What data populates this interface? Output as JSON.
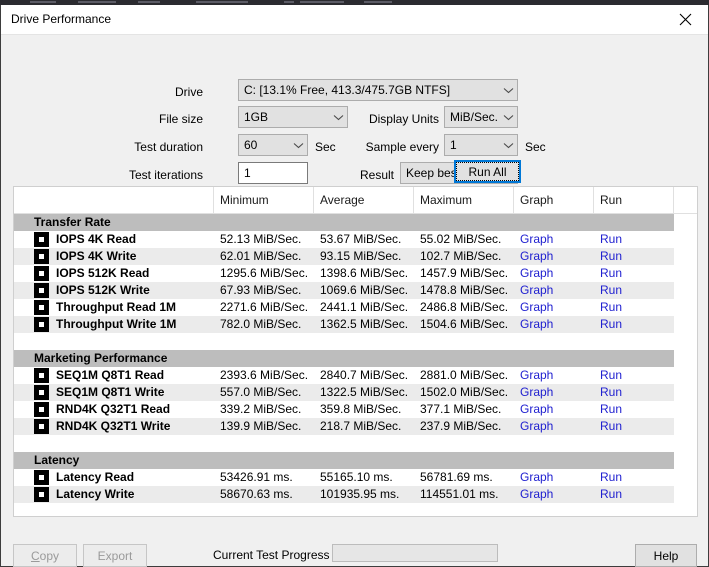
{
  "window": {
    "title": "Drive Performance",
    "close_icon": "close-icon"
  },
  "form": {
    "drive_label": "Drive",
    "drive_value": "C: [13.1% Free, 413.3/475.7GB NTFS]",
    "file_size_label": "File size",
    "file_size_value": "1GB",
    "display_units_label": "Display Units",
    "display_units_value": "MiB/Sec.",
    "test_duration_label": "Test duration",
    "test_duration_value": "60",
    "test_duration_unit": "Sec",
    "sample_every_label": "Sample every",
    "sample_every_value": "1",
    "sample_every_unit": "Sec",
    "test_iterations_label": "Test iterations",
    "test_iterations_value": "1",
    "result_label": "Result",
    "result_value": "Keep best result",
    "run_all_label": "Run All"
  },
  "table": {
    "columns": [
      "",
      "Minimum",
      "Average",
      "Maximum",
      "Graph",
      "Run"
    ],
    "graph_link": "Graph",
    "run_link": "Run",
    "groups": [
      {
        "title": "Transfer Rate",
        "rows": [
          {
            "name": "IOPS 4K Read",
            "minimum": "52.13 MiB/Sec.",
            "average": "53.67 MiB/Sec.",
            "maximum": "55.02 MiB/Sec."
          },
          {
            "name": "IOPS 4K Write",
            "minimum": "62.01 MiB/Sec.",
            "average": "93.15 MiB/Sec.",
            "maximum": "102.7 MiB/Sec."
          },
          {
            "name": "IOPS 512K Read",
            "minimum": "1295.6 MiB/Sec.",
            "average": "1398.6 MiB/Sec.",
            "maximum": "1457.9 MiB/Sec."
          },
          {
            "name": "IOPS 512K Write",
            "minimum": "67.93 MiB/Sec.",
            "average": "1069.6 MiB/Sec.",
            "maximum": "1478.8 MiB/Sec."
          },
          {
            "name": "Throughput Read 1M",
            "minimum": "2271.6 MiB/Sec.",
            "average": "2441.1 MiB/Sec.",
            "maximum": "2486.8 MiB/Sec."
          },
          {
            "name": "Throughput Write 1M",
            "minimum": "782.0 MiB/Sec.",
            "average": "1362.5 MiB/Sec.",
            "maximum": "1504.6 MiB/Sec."
          }
        ]
      },
      {
        "title": "Marketing Performance",
        "rows": [
          {
            "name": "SEQ1M Q8T1 Read",
            "minimum": "2393.6 MiB/Sec.",
            "average": "2840.7 MiB/Sec.",
            "maximum": "2881.0 MiB/Sec."
          },
          {
            "name": "SEQ1M Q8T1 Write",
            "minimum": "557.0 MiB/Sec.",
            "average": "1322.5 MiB/Sec.",
            "maximum": "1502.0 MiB/Sec."
          },
          {
            "name": "RND4K Q32T1 Read",
            "minimum": "339.2 MiB/Sec.",
            "average": "359.8 MiB/Sec.",
            "maximum": "377.1 MiB/Sec."
          },
          {
            "name": "RND4K Q32T1 Write",
            "minimum": "139.9 MiB/Sec.",
            "average": "218.7 MiB/Sec.",
            "maximum": "237.9 MiB/Sec."
          }
        ]
      },
      {
        "title": "Latency",
        "rows": [
          {
            "name": "Latency Read",
            "minimum": "53426.91 ms.",
            "average": "55165.10 ms.",
            "maximum": "56781.69 ms."
          },
          {
            "name": "Latency Write",
            "minimum": "58670.63 ms.",
            "average": "101935.95 ms.",
            "maximum": "114551.01 ms."
          }
        ]
      }
    ]
  },
  "footer": {
    "copy_label": "Copy",
    "copy_accel": "C",
    "copy_rest": "opy",
    "export_label": "Export",
    "progress_label": "Current Test Progress",
    "progress_percent": 0,
    "help_label": "Help"
  }
}
